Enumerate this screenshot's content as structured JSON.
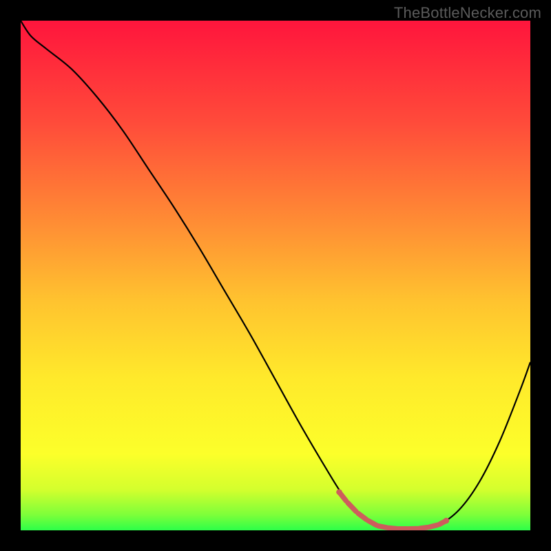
{
  "watermark": "TheBottleNecker.com",
  "colors": {
    "page_bg": "#000000",
    "curve": "#000000",
    "marker": "#cd5d5c",
    "watermark_text": "#5b5b5b"
  },
  "chart_data": {
    "type": "line",
    "title": "",
    "xlabel": "",
    "ylabel": "",
    "xlim": [
      0,
      100
    ],
    "ylim": [
      0,
      100
    ],
    "gradient_stops": [
      {
        "offset": 0.0,
        "color": "#ff153c"
      },
      {
        "offset": 0.2,
        "color": "#ff4b3a"
      },
      {
        "offset": 0.4,
        "color": "#ff8e34"
      },
      {
        "offset": 0.55,
        "color": "#ffc32f"
      },
      {
        "offset": 0.7,
        "color": "#ffe92b"
      },
      {
        "offset": 0.85,
        "color": "#fcff2a"
      },
      {
        "offset": 0.92,
        "color": "#d4ff2d"
      },
      {
        "offset": 0.97,
        "color": "#7cff3a"
      },
      {
        "offset": 1.0,
        "color": "#2cff49"
      }
    ],
    "series": [
      {
        "name": "bottleneck_curve",
        "x": [
          0,
          2,
          5,
          10,
          15,
          20,
          25,
          30,
          35,
          40,
          45,
          50,
          55,
          60,
          63,
          66,
          70,
          74,
          78,
          82,
          86,
          90,
          94,
          98,
          100
        ],
        "y": [
          100,
          97,
          94.5,
          90.5,
          85,
          78.5,
          71,
          63.5,
          55.5,
          47,
          38.5,
          29.5,
          20.5,
          12,
          7.2,
          3.5,
          0.9,
          0.3,
          0.35,
          1.1,
          4.0,
          9.5,
          17.5,
          27.5,
          33
        ]
      }
    ],
    "marker_zone": {
      "color": "#cd5d5c",
      "x": [
        62.5,
        64.0,
        66.0,
        68.0,
        70.0,
        72.0,
        74.0,
        76.0,
        78.0,
        80.0,
        82.0,
        83.5
      ],
      "y": [
        7.5,
        5.6,
        3.5,
        2.0,
        0.9,
        0.5,
        0.3,
        0.3,
        0.35,
        0.6,
        1.1,
        1.9
      ]
    }
  }
}
